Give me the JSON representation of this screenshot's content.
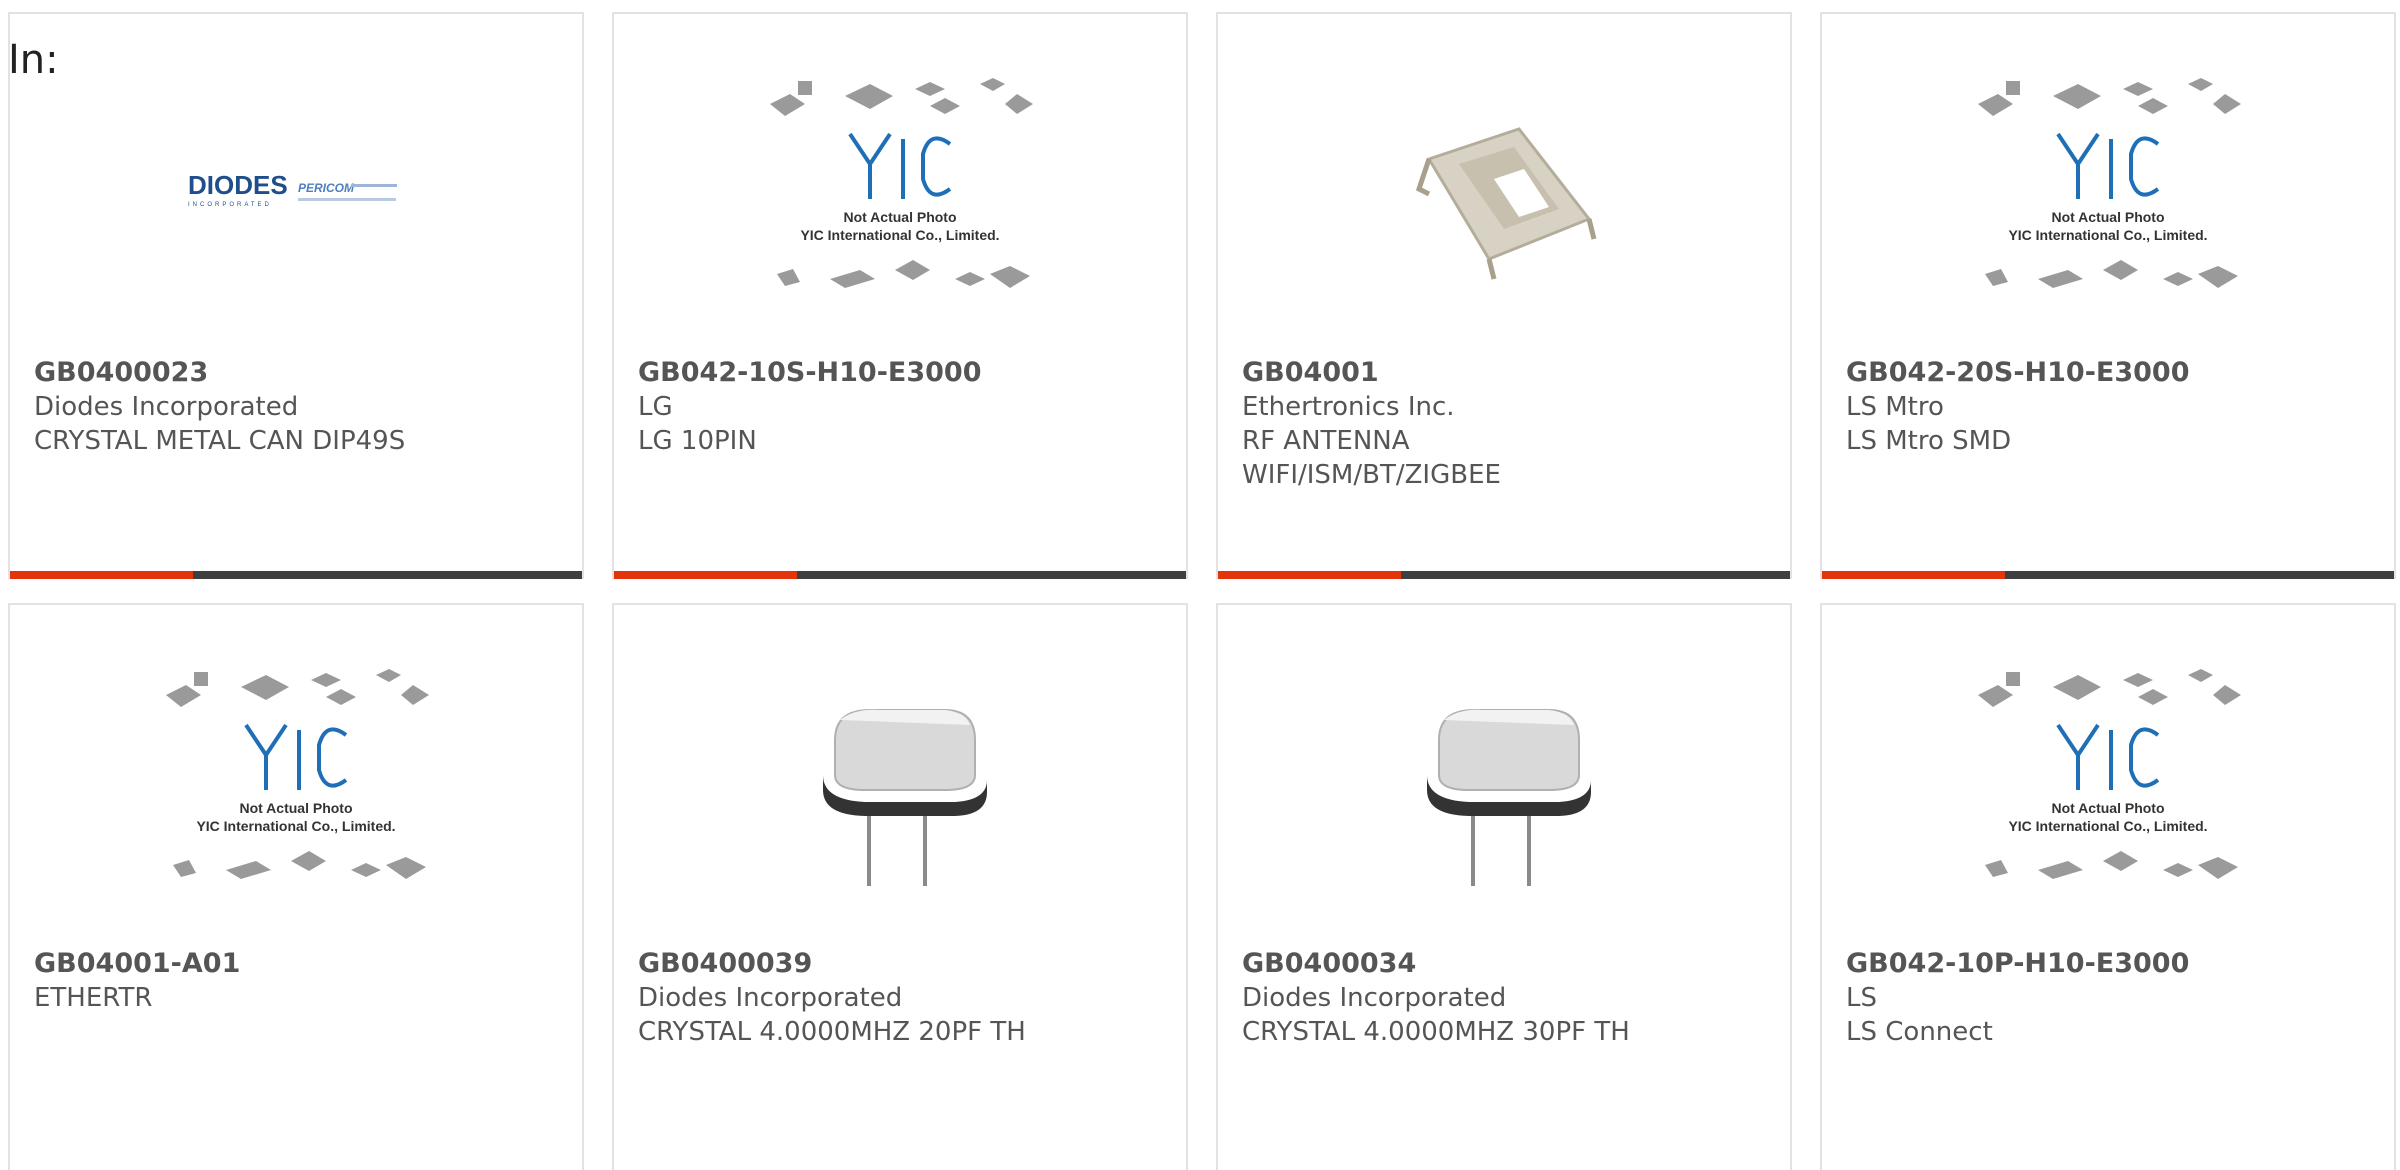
{
  "page": {
    "in_label": "In:"
  },
  "placeholder": {
    "brand": "YIC",
    "caption_line1": "Not Actual Photo",
    "caption_line2": "YIC International Co., Limited."
  },
  "diodes_logo": {
    "main": "DIODES",
    "sub": "INCORPORATED",
    "right": "PERICOM"
  },
  "colors": {
    "accent": "#e3340c",
    "bar": "#3e3f40",
    "text": "#555555",
    "border": "#e2e2e2",
    "yic_blue": "#1f6fb6"
  },
  "products": [
    {
      "part_number": "GB0400023",
      "manufacturer": "Diodes Incorporated",
      "description": [
        "CRYSTAL METAL CAN DIP49S"
      ],
      "image": "diodes-pericom-logo"
    },
    {
      "part_number": "GB042-10S-H10-E3000",
      "manufacturer": "LG",
      "description": [
        "LG 10PIN"
      ],
      "image": "yic-placeholder"
    },
    {
      "part_number": "GB04001",
      "manufacturer": "Ethertronics Inc.",
      "description": [
        "RF ANTENNA",
        "WIFI/ISM/BT/ZIGBEE"
      ],
      "image": "rf-antenna-photo"
    },
    {
      "part_number": "GB042-20S-H10-E3000",
      "manufacturer": "LS Mtro",
      "description": [
        "LS Mtro SMD"
      ],
      "image": "yic-placeholder"
    },
    {
      "part_number": "GB04001-A01",
      "manufacturer": "ETHERTR",
      "description": [],
      "image": "yic-placeholder"
    },
    {
      "part_number": "GB0400039",
      "manufacturer": "Diodes Incorporated",
      "description": [
        "CRYSTAL 4.0000MHZ 20PF TH"
      ],
      "image": "crystal-photo"
    },
    {
      "part_number": "GB0400034",
      "manufacturer": "Diodes Incorporated",
      "description": [
        "CRYSTAL 4.0000MHZ 30PF TH"
      ],
      "image": "crystal-photo"
    },
    {
      "part_number": "GB042-10P-H10-E3000",
      "manufacturer": "LS",
      "description": [
        "LS Connect"
      ],
      "image": "yic-placeholder"
    }
  ]
}
